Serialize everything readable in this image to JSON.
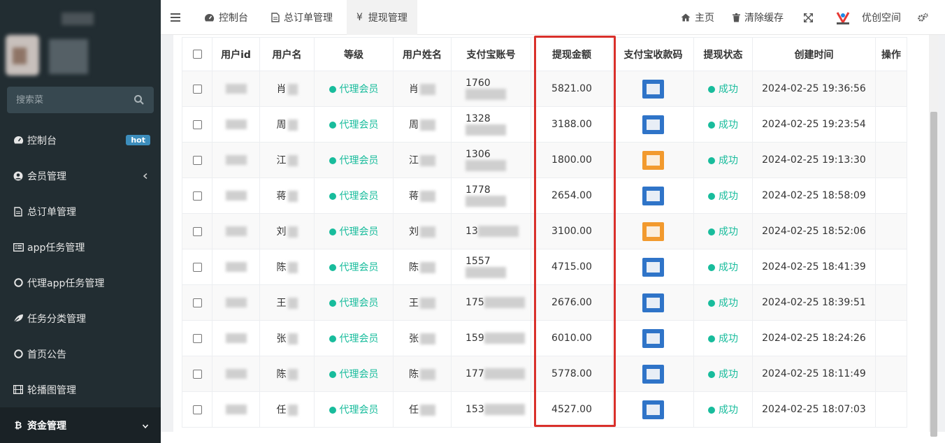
{
  "sidebar": {
    "search_placeholder": "搜索菜",
    "items": [
      {
        "label": "控制台",
        "icon": "dashboard-icon",
        "badge": "hot"
      },
      {
        "label": "会员管理",
        "icon": "user-icon"
      },
      {
        "label": "总订单管理",
        "icon": "file-icon"
      },
      {
        "label": "app任务管理",
        "icon": "list-alt-icon"
      },
      {
        "label": "代理app任务管理",
        "icon": "circle-icon"
      },
      {
        "label": "任务分类管理",
        "icon": "leaf-icon"
      },
      {
        "label": "首页公告",
        "icon": "circle-icon"
      },
      {
        "label": "轮播图管理",
        "icon": "film-icon"
      },
      {
        "label": "资金管理",
        "icon": "bitcoin-icon"
      }
    ]
  },
  "navbar": {
    "tabs": [
      {
        "label": "控制台",
        "icon": "dashboard-icon"
      },
      {
        "label": "总订单管理",
        "icon": "file-icon"
      },
      {
        "label": "提现管理",
        "icon": "yen-icon"
      }
    ],
    "home": "主页",
    "clear_cache": "清除缓存",
    "brand": "优创空间"
  },
  "table": {
    "headers": [
      "用户id",
      "用户名",
      "等级",
      "用户姓名",
      "支付宝账号",
      "提现金额",
      "支付宝收款码",
      "提现状态",
      "创建时间",
      "操作"
    ],
    "rows": [
      {
        "name": "肖",
        "level": "代理会员",
        "realname": "肖",
        "account": "1760",
        "amount": "5821.00",
        "qr": "blue",
        "status": "成功",
        "time": "2024-02-25 19:36:56"
      },
      {
        "name": "周",
        "level": "代理会员",
        "realname": "周",
        "account": "1328",
        "amount": "3188.00",
        "qr": "blue",
        "status": "成功",
        "time": "2024-02-25 19:23:54"
      },
      {
        "name": "江",
        "level": "代理会员",
        "realname": "江",
        "account": "1306",
        "amount": "1800.00",
        "qr": "orange",
        "status": "成功",
        "time": "2024-02-25 19:13:30"
      },
      {
        "name": "蒋",
        "level": "代理会员",
        "realname": "蒋",
        "account": "1778",
        "amount": "2654.00",
        "qr": "blue",
        "status": "成功",
        "time": "2024-02-25 18:58:09"
      },
      {
        "name": "刘",
        "level": "代理会员",
        "realname": "刘",
        "account": "13",
        "amount": "3100.00",
        "qr": "orange",
        "status": "成功",
        "time": "2024-02-25 18:52:06"
      },
      {
        "name": "陈",
        "level": "代理会员",
        "realname": "陈",
        "account": "1557",
        "amount": "4715.00",
        "qr": "blue",
        "status": "成功",
        "time": "2024-02-25 18:41:39"
      },
      {
        "name": "王",
        "level": "代理会员",
        "realname": "王",
        "account": "175",
        "amount": "2676.00",
        "qr": "blue",
        "status": "成功",
        "time": "2024-02-25 18:39:51"
      },
      {
        "name": "张",
        "level": "代理会员",
        "realname": "张",
        "account": "159",
        "amount": "6010.00",
        "qr": "blue",
        "status": "成功",
        "time": "2024-02-25 18:24:26"
      },
      {
        "name": "陈",
        "level": "代理会员",
        "realname": "陈",
        "account": "177",
        "amount": "5778.00",
        "qr": "blue",
        "status": "成功",
        "time": "2024-02-25 18:11:49"
      },
      {
        "name": "任",
        "level": "代理会员",
        "realname": "任",
        "account": "153",
        "amount": "4527.00",
        "qr": "blue",
        "status": "成功",
        "time": "2024-02-25 18:07:03"
      }
    ]
  }
}
